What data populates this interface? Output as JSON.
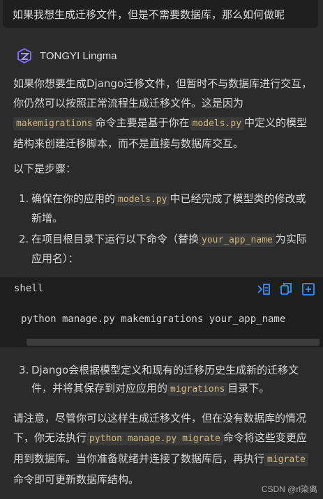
{
  "user_message": "如果我想生成迁移文件，但是不需要数据库，那么如何做呢",
  "bot": {
    "name": "TONGYI Lingma"
  },
  "intro": {
    "t1": "如果你想要生成Django迁移文件，但暂时不与数据库进行交互，你仍然可以按照正常流程生成迁移文件。这是因为",
    "code1": "makemigrations",
    "t2": "命令主要是基于你在",
    "code2": "models.py",
    "t3": "中定义的模型结构来创建迁移脚本，而不是直接与数据库交互。"
  },
  "steps_heading": "以下是步骤：",
  "steps": [
    {
      "num": "1.",
      "t1": "确保在你的应用的",
      "code": "models.py",
      "t2": "中已经完成了模型类的修改或新增。"
    },
    {
      "num": "2.",
      "t1": "在项目根目录下运行以下命令（替换",
      "code": "your_app_name",
      "t2": "为实际应用名）："
    },
    {
      "num": "3.",
      "t1": "Django会根据模型定义和现有的迁移历史生成新的迁移文件，并将其保存到对应应用的",
      "code": "migrations",
      "t2": "目录下。"
    }
  ],
  "code_block": {
    "lang": "shell",
    "code": "python manage.py makemigrations your_app_name",
    "icons": [
      "insert-icon",
      "copy-icon",
      "new-file-icon"
    ]
  },
  "note": {
    "t1": "请注意，尽管你可以这样生成迁移文件，但在没有数据库的情况下，你无法执行",
    "code1": "python manage.py migrate",
    "t2": "命令将这些变更应用到数据库。当你准备就绪并连接了数据库后，再执行",
    "code2": "migrate",
    "t3": "命令即可更新数据库结构。"
  },
  "watermark": "CSDN @rl染离",
  "colors": {
    "accent": "#3794ff",
    "code_text": "#d7ba7d",
    "logo": "#7b6cf6"
  }
}
